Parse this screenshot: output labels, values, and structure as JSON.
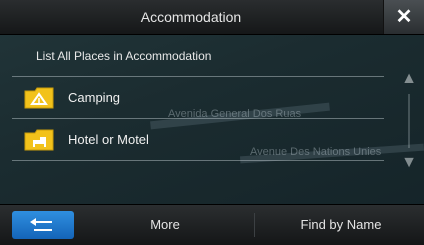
{
  "header": {
    "title": "Accommodation",
    "close_icon": "close-icon"
  },
  "list": {
    "header_label": "List All Places in Accommodation",
    "items": [
      {
        "label": "Camping",
        "icon": "camping-folder-icon"
      },
      {
        "label": "Hotel or Motel",
        "icon": "hotel-folder-icon"
      }
    ]
  },
  "map_background": {
    "street_labels": [
      "Avenida General Dos Ruas",
      "Avenue Des Nations Unies"
    ]
  },
  "scroll": {
    "up_icon": "scroll-up-icon",
    "down_icon": "scroll-down-icon"
  },
  "footer": {
    "back_icon": "back-arrow-icon",
    "more_label": "More",
    "find_label": "Find by Name"
  },
  "colors": {
    "accent_blue": "#1f7fd6",
    "folder_yellow": "#f2c21b",
    "bar_dark": "#1d1f21"
  }
}
